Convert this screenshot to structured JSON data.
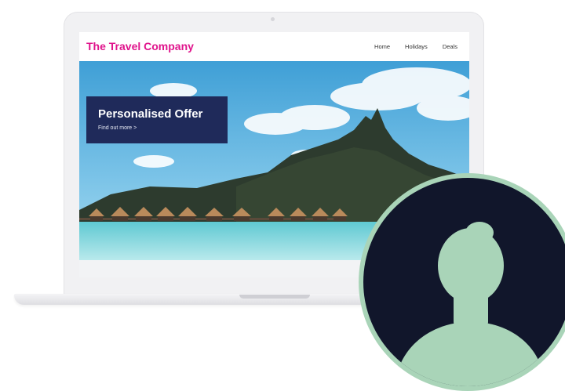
{
  "site": {
    "brand": "The Travel Company",
    "nav": [
      "Home",
      "Holidays",
      "Deals"
    ]
  },
  "hero": {
    "offer_title": "Personalised Offer",
    "offer_link": "Find out more >"
  },
  "colors": {
    "brand_pink": "#e0148c",
    "offer_navy": "#1f2a5a",
    "avatar_bg": "#11162b",
    "avatar_silhouette": "#a9d4b8"
  },
  "icons": {
    "avatar": "user-silhouette-icon"
  }
}
